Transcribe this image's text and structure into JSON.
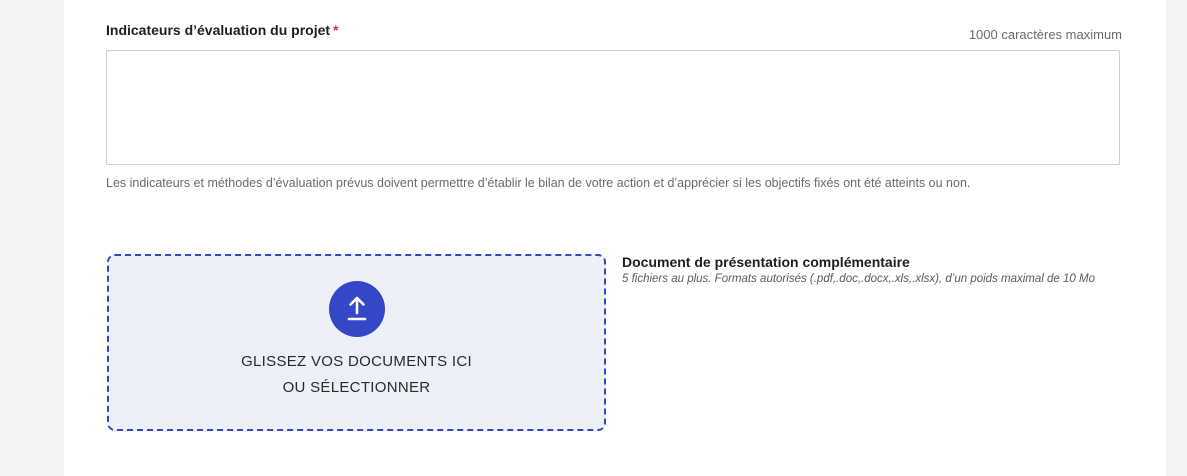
{
  "field": {
    "label": "Indicateurs d’évaluation du projet",
    "required_marker": "*",
    "char_limit": "1000 caractères maximum",
    "value": "",
    "help": "Les indicateurs et méthodes d’évaluation prévus doivent permettre d’établir le bilan de votre action et d’apprécier si les objectifs fixés ont été atteints ou non."
  },
  "upload": {
    "icon": "upload-arrow-icon",
    "line1": "GLISSEZ VOS DOCUMENTS ICI",
    "line2": "OU SÉLECTIONNER",
    "title": "Document de présentation complémentaire",
    "description": "5 fichiers au plus. Formats autorisés (.pdf,.doc,.docx,.xls,.xlsx), d’un poids maximal de 10 Mo"
  },
  "colors": {
    "accent": "#3347c7",
    "required": "#d1372f",
    "dropzone_bg": "#eef0f9",
    "page_bg": "#f3f3f3"
  }
}
